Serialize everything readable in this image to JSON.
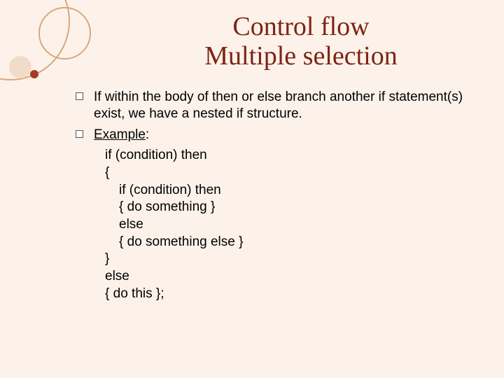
{
  "title": {
    "line1": "Control flow",
    "line2": "Multiple selection"
  },
  "bullets": [
    {
      "parts": [
        "If within the body of ",
        "then",
        " or ",
        "else",
        " branch another if statement(s) exist, we have a nested if structure."
      ]
    },
    {
      "label": "Example",
      "colon": ":"
    }
  ],
  "code": [
    "if (condition) then",
    "{",
    "if (condition) then",
    "{ do something }",
    "else",
    "{ do something else }",
    "}",
    "else",
    "{ do this };"
  ],
  "colors": {
    "background": "#fcf2ea",
    "title": "#7d2414",
    "accent_outline": "#d9a87a",
    "accent_fill": "#f0dcc9",
    "accent_dot": "#a43b2a"
  }
}
